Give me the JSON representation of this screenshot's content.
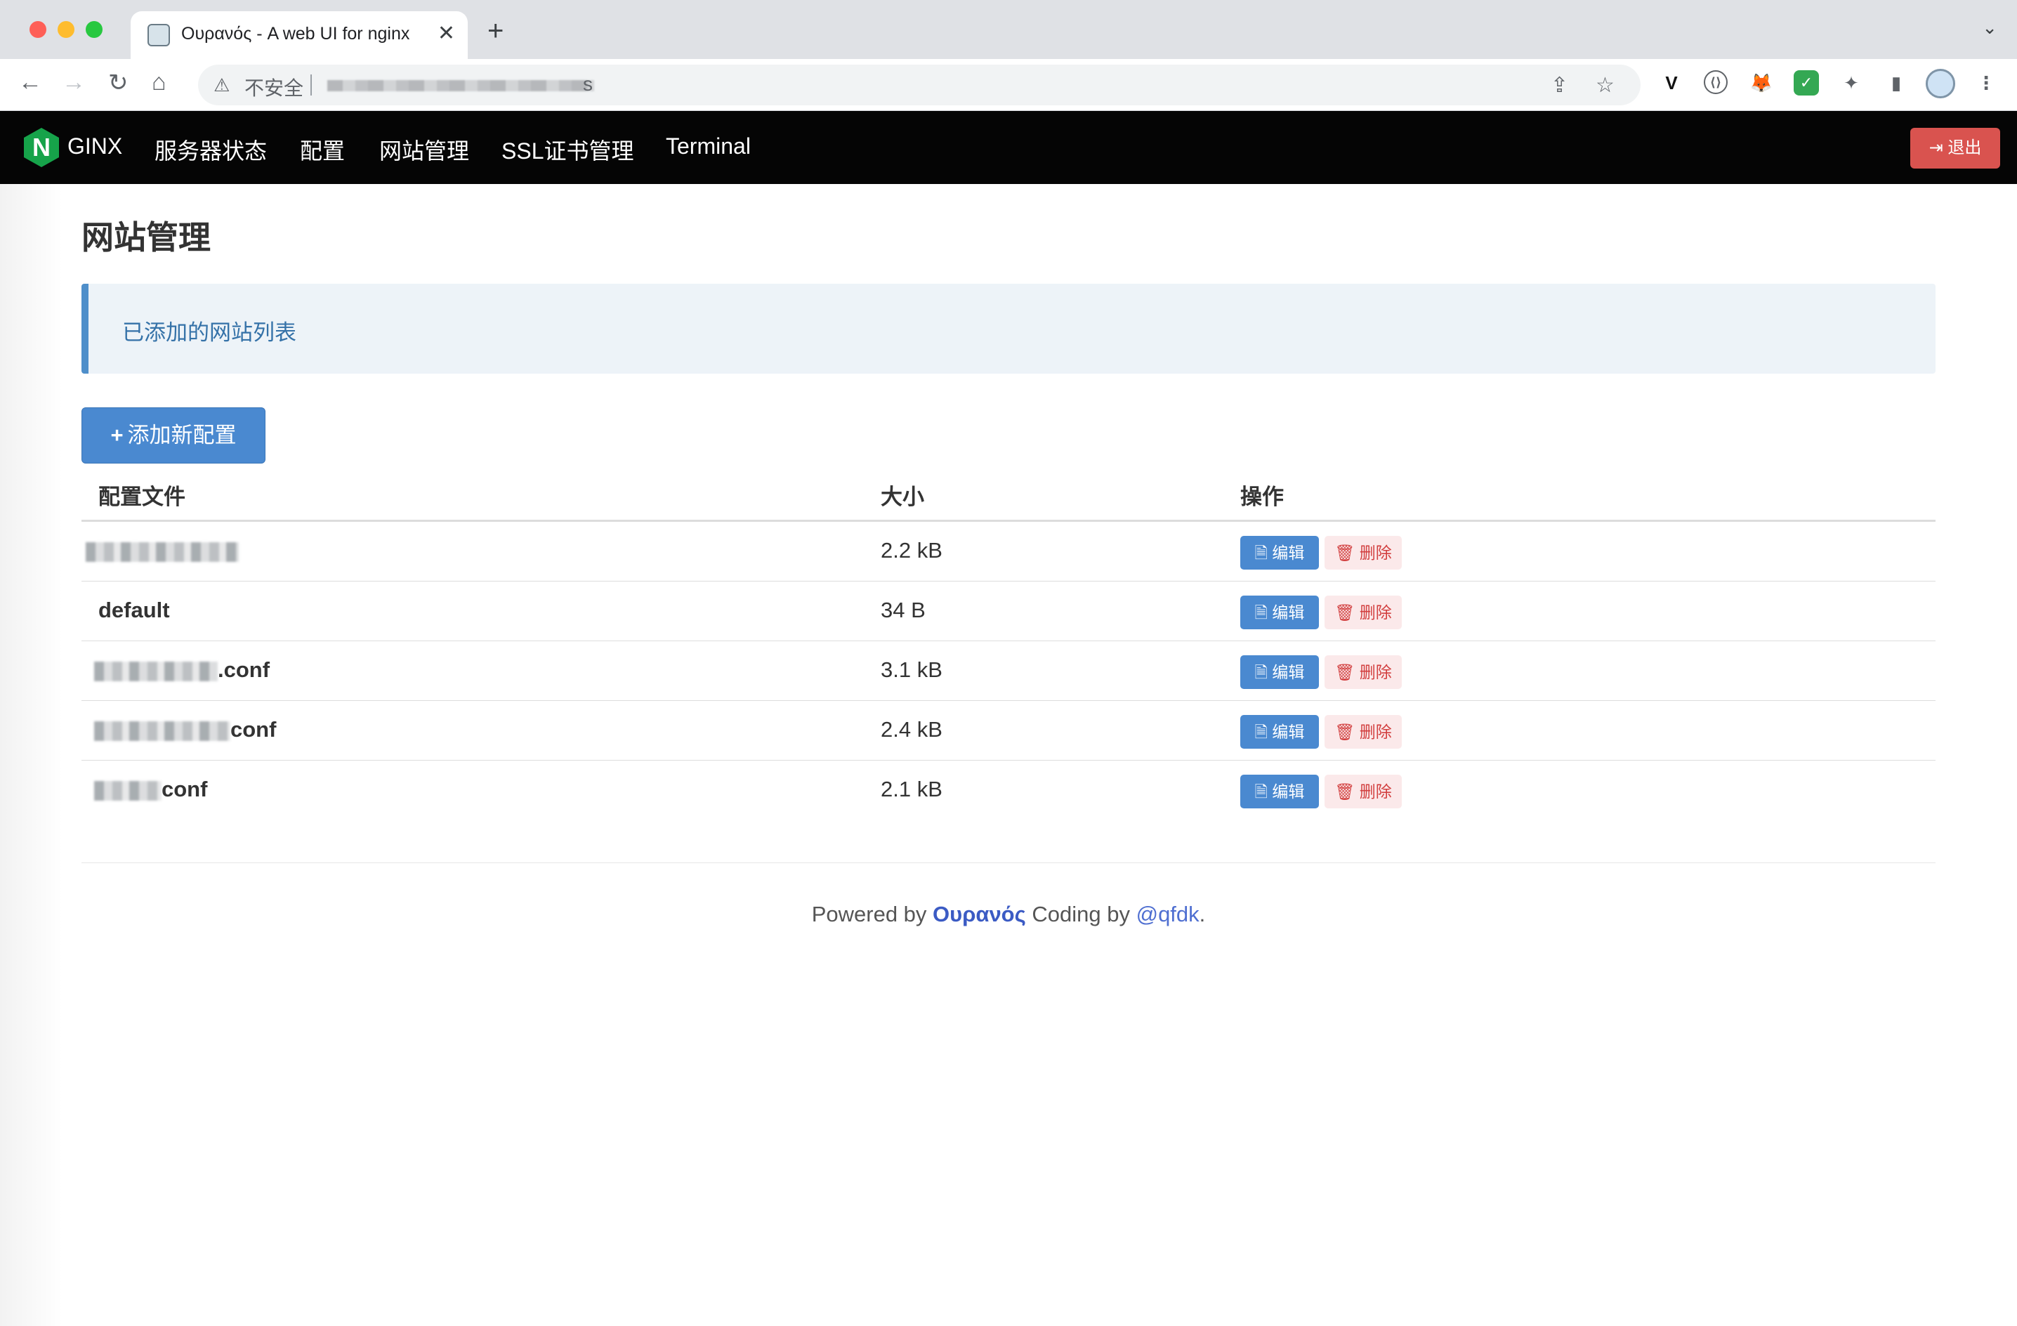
{
  "browser": {
    "tab_title": "Ουρανός - A web UI for nginx",
    "tab_close": "✕",
    "new_tab": "+",
    "tab_menu": "⌄",
    "insecure_label": "不安全",
    "url_tail": "s"
  },
  "navbar": {
    "brand_letter": "N",
    "brand_text": "GINX",
    "links": [
      "服务器状态",
      "配置",
      "网站管理",
      "SSL证书管理",
      "Terminal"
    ],
    "logout_label": "⇥ 退出"
  },
  "page": {
    "title": "网站管理",
    "info_text": "已添加的网站列表",
    "add_button_label": "添加新配置",
    "add_button_icon": "+"
  },
  "table": {
    "headers": [
      "配置文件",
      "大小",
      "操作"
    ],
    "rows": [
      {
        "name": "",
        "size": "2.2 kB"
      },
      {
        "name": "default",
        "size": "34 B"
      },
      {
        "name": ".conf",
        "size": "3.1 kB"
      },
      {
        "name": "conf",
        "size": "2.4 kB"
      },
      {
        "name": "conf",
        "size": "2.1 kB"
      }
    ],
    "edit_label": "🗎 编辑",
    "delete_label": "🗑 删除"
  },
  "footer": {
    "prefix": "Powered by",
    "brand": "Ουρανός",
    "middle": "Coding by",
    "author": "@qfdk",
    "suffix": "."
  }
}
